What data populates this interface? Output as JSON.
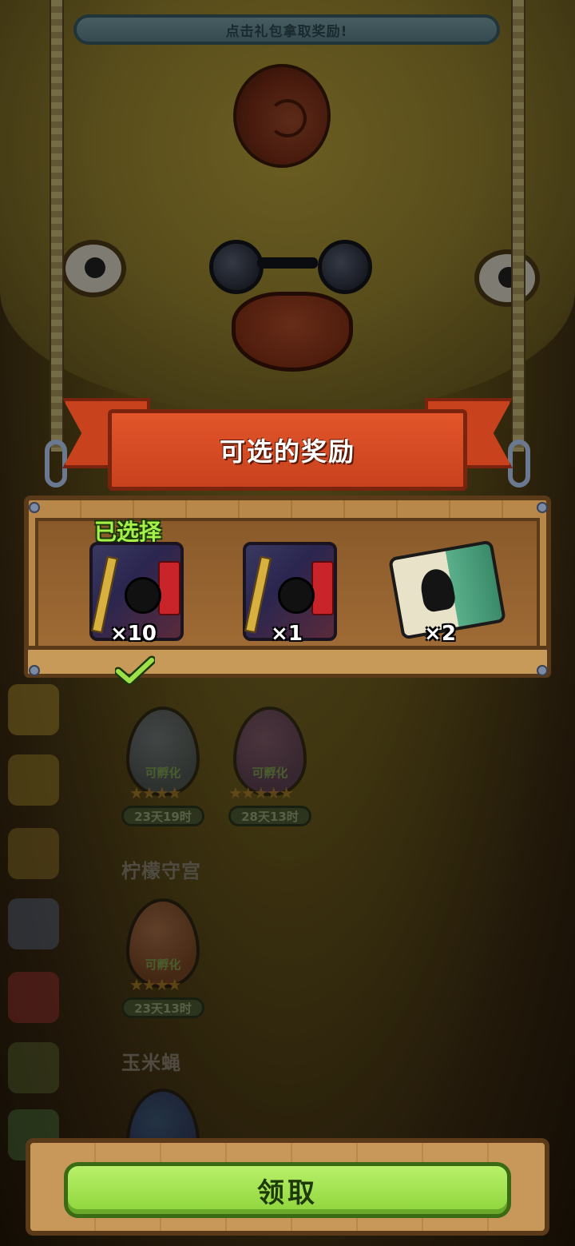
{
  "hint_bar": {
    "text": "点击礼包拿取奖励!"
  },
  "reward_panel": {
    "title": "可选的奖励",
    "selected_label": "已选择",
    "rewards": [
      {
        "icon": "gift-bundle-icon",
        "quantity": "×10",
        "selected": true
      },
      {
        "icon": "gift-bundle-icon",
        "quantity": "×1",
        "selected": false
      },
      {
        "icon": "ticket-card-icon",
        "quantity": "×2",
        "selected": false
      }
    ]
  },
  "hatchery": {
    "sections": [
      {
        "title": "",
        "eggs": [
          {
            "status": "可孵化",
            "stars": "★★★★",
            "timer": "23天19时"
          },
          {
            "status": "可孵化",
            "stars": "★★★★★",
            "timer": "28天13时"
          }
        ]
      },
      {
        "title": "柠檬守宫",
        "eggs": [
          {
            "status": "可孵化",
            "stars": "★★★★",
            "timer": "23天13时"
          }
        ]
      },
      {
        "title": "玉米蝇",
        "eggs": []
      }
    ]
  },
  "claim_button": {
    "label": "领取"
  },
  "colors": {
    "ribbon": "#c8421e",
    "selected_green": "#a6f04a",
    "claim_button": "#a6e84a",
    "hint_bar": "#6a9098"
  }
}
